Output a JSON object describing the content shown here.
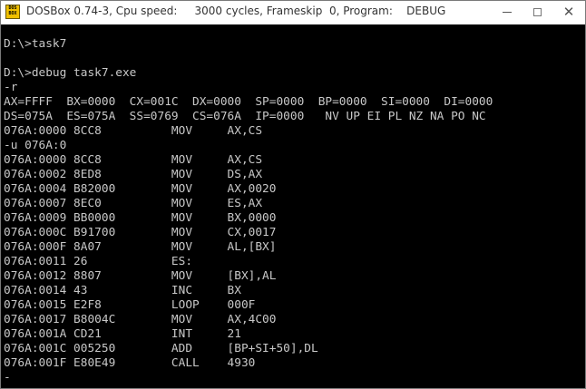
{
  "window": {
    "title": "DOSBox 0.74-3, Cpu speed:     3000 cycles, Frameskip  0, Program:    DEBUG",
    "icon_text": "DOS BOX",
    "icon_name": "dosbox-app-icon"
  },
  "console": {
    "text_color": "#c8c8c8",
    "background": "#000000",
    "lines": [
      "D:\\>task7",
      "",
      "D:\\>debug task7.exe",
      "-r",
      "AX=FFFF  BX=0000  CX=001C  DX=0000  SP=0000  BP=0000  SI=0000  DI=0000",
      "DS=075A  ES=075A  SS=0769  CS=076A  IP=0000   NV UP EI PL NZ NA PO NC",
      "076A:0000 8CC8          MOV     AX,CS",
      "-u 076A:0",
      "076A:0000 8CC8          MOV     AX,CS",
      "076A:0002 8ED8          MOV     DS,AX",
      "076A:0004 B82000        MOV     AX,0020",
      "076A:0007 8EC0          MOV     ES,AX",
      "076A:0009 BB0000        MOV     BX,0000",
      "076A:000C B91700        MOV     CX,0017",
      "076A:000F 8A07          MOV     AL,[BX]",
      "076A:0011 26            ES:",
      "076A:0012 8807          MOV     [BX],AL",
      "076A:0014 43            INC     BX",
      "076A:0015 E2F8          LOOP    000F",
      "076A:0017 B8004C        MOV     AX,4C00",
      "076A:001A CD21          INT     21",
      "076A:001C 005250        ADD     [BP+SI+50],DL",
      "076A:001F E80E49        CALL    4930",
      "-"
    ]
  }
}
